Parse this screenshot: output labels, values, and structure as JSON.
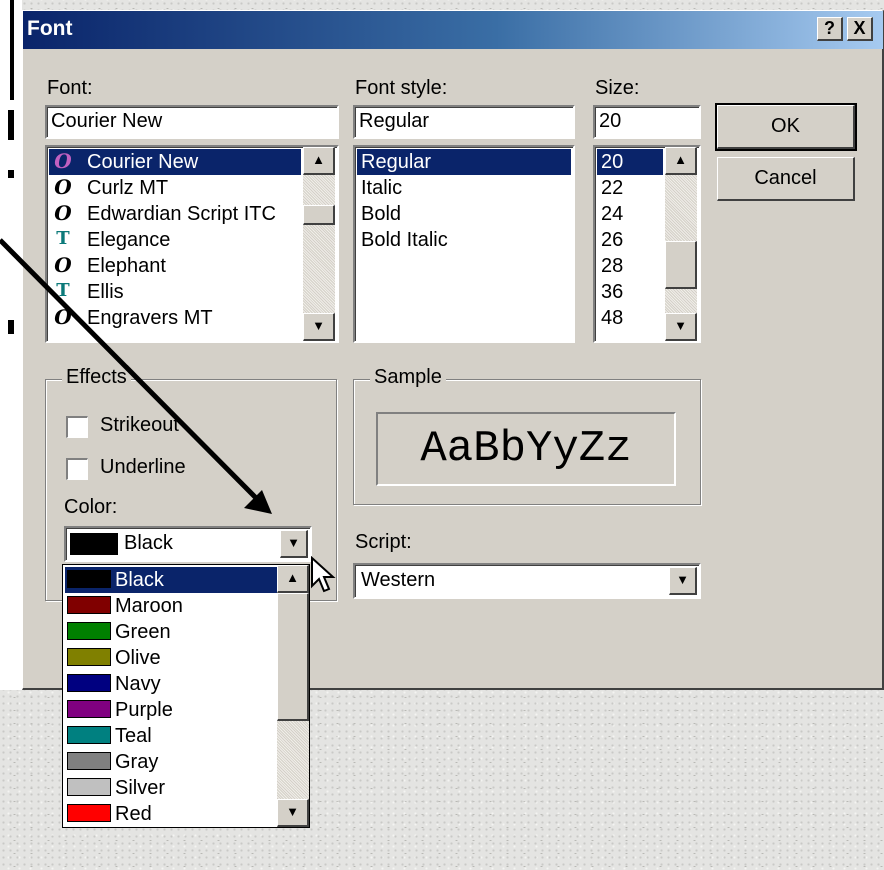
{
  "dialog": {
    "title": "Font",
    "help_button": "?",
    "close_button": "X"
  },
  "font": {
    "label": "Font:",
    "value": "Courier New",
    "items": [
      {
        "name": "Courier New",
        "icon": "opentype-icon",
        "selected": true
      },
      {
        "name": "Curlz MT",
        "icon": "opentype-icon",
        "selected": false
      },
      {
        "name": "Edwardian Script ITC",
        "icon": "opentype-icon",
        "selected": false
      },
      {
        "name": "Elegance",
        "icon": "truetype-icon",
        "selected": false
      },
      {
        "name": "Elephant",
        "icon": "opentype-icon",
        "selected": false
      },
      {
        "name": "Ellis",
        "icon": "truetype-icon",
        "selected": false
      },
      {
        "name": "Engravers MT",
        "icon": "opentype-icon",
        "selected": false
      }
    ]
  },
  "font_style": {
    "label": "Font style:",
    "value": "Regular",
    "items": [
      "Regular",
      "Italic",
      "Bold",
      "Bold Italic"
    ],
    "selected_index": 0
  },
  "size": {
    "label": "Size:",
    "value": "20",
    "items": [
      "20",
      "22",
      "24",
      "26",
      "28",
      "36",
      "48"
    ],
    "selected_index": 0
  },
  "buttons": {
    "ok": "OK",
    "cancel": "Cancel"
  },
  "effects": {
    "label": "Effects",
    "strikeout_label": "Strikeout",
    "strikeout_checked": false,
    "underline_label": "Underline",
    "underline_checked": false,
    "color_label": "Color:",
    "color_value": "Black",
    "color_swatch": "#000000"
  },
  "sample": {
    "label": "Sample",
    "text": "AaBbYyZz"
  },
  "script": {
    "label": "Script:",
    "value": "Western"
  },
  "color_dropdown": {
    "items": [
      {
        "name": "Black",
        "color": "#000000",
        "selected": true
      },
      {
        "name": "Maroon",
        "color": "#800000",
        "selected": false
      },
      {
        "name": "Green",
        "color": "#008000",
        "selected": false
      },
      {
        "name": "Olive",
        "color": "#808000",
        "selected": false
      },
      {
        "name": "Navy",
        "color": "#000080",
        "selected": false
      },
      {
        "name": "Purple",
        "color": "#800080",
        "selected": false
      },
      {
        "name": "Teal",
        "color": "#008080",
        "selected": false
      },
      {
        "name": "Gray",
        "color": "#808080",
        "selected": false
      },
      {
        "name": "Silver",
        "color": "#c0c0c0",
        "selected": false
      },
      {
        "name": "Red",
        "color": "#ff0000",
        "selected": false
      }
    ]
  },
  "colors": {
    "titlebar_start": "#0a246a",
    "titlebar_end": "#a6caf0",
    "selection": "#0a246a",
    "face": "#d4d0c8"
  }
}
